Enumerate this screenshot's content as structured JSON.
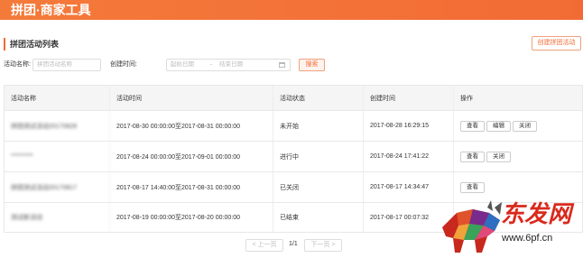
{
  "header": {
    "brand": "拼团·商家工具"
  },
  "page": {
    "title": "拼团活动列表",
    "create_button": "创建拼团活动"
  },
  "filters": {
    "name_label": "活动名称:",
    "name_placeholder": "拼团活动名称",
    "time_label": "创建时间:",
    "start_placeholder": "起始日期",
    "separator": "-",
    "end_placeholder": "结束日期",
    "search_button": "搜索"
  },
  "table": {
    "columns": [
      "活动名称",
      "活动时间",
      "活动状态",
      "创建时间",
      "操作"
    ],
    "rows": [
      {
        "name": "拼团测试活动20170828",
        "time": "2017-08-30 00:00:00至2017-08-31 00:00:00",
        "status": "未开始",
        "created": "2017-08-28 16:29:15",
        "actions": [
          "查看",
          "编辑",
          "关闭"
        ]
      },
      {
        "name": "*********",
        "time": "2017-08-24 00:00:00至2017-09-01 00:00:00",
        "status": "进行中",
        "created": "2017-08-24 17:41:22",
        "actions": [
          "查看",
          "关闭"
        ]
      },
      {
        "name": "拼团测试活动20170817",
        "time": "2017-08-17 14:40:00至2017-08-31 00:00:00",
        "status": "已关闭",
        "created": "2017-08-17 14:34:47",
        "actions": [
          "查看"
        ]
      },
      {
        "name": "测试新活动",
        "time": "2017-08-19 00:00:00至2017-08-20 00:00:00",
        "status": "已结束",
        "created": "2017-08-17 00:07:32",
        "actions": []
      }
    ]
  },
  "pagination": {
    "prev": "< 上一页",
    "info": "1/1",
    "next": "下一页 >"
  },
  "watermark": {
    "text": "东发网",
    "url": "www.6pf.cn"
  },
  "colors": {
    "accent": "#f26b35",
    "header_bg": "#f47a3a",
    "watermark_red": "#d92a1c"
  }
}
